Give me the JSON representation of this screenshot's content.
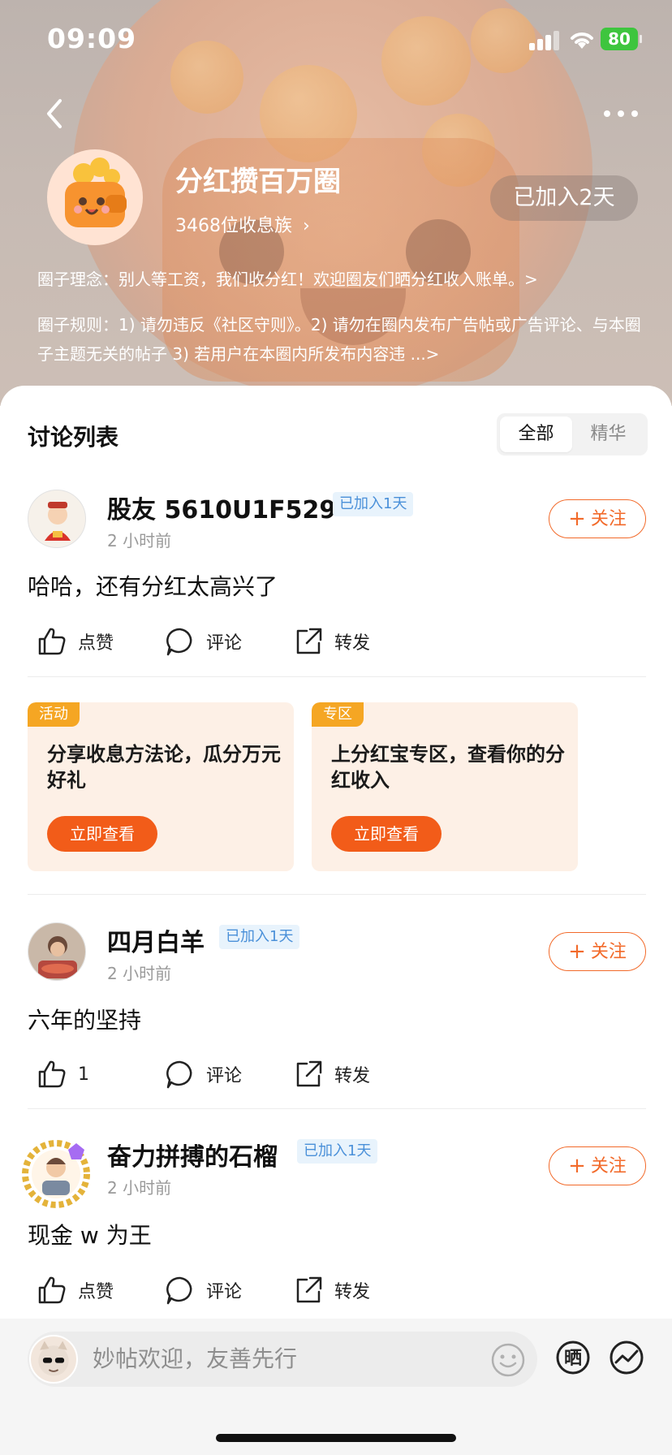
{
  "status_bar": {
    "time": "09:09",
    "battery": "80"
  },
  "header": {
    "circle_name": "分红攒百万圈",
    "members": "3468位收息族",
    "joined": "已加入2天",
    "philosophy": "圈子理念：别人等工资，我们收分红！欢迎圈友们晒分红收入账单。>",
    "rules": "圈子规则：1) 请勿违反《社区守则》。2) 请勿在圈内发布广告帖或广告评论、与本圈子主题无关的帖子 3) 若用户在本圈内所发布内容违 ...>"
  },
  "list": {
    "title": "讨论列表",
    "tabs": [
      "全部",
      "精华"
    ],
    "active_tab": "全部"
  },
  "follow_label": "关注",
  "comment_label": "评论",
  "forward_label": "转发",
  "posts": [
    {
      "username": "股友 5610U1F529",
      "badge": "已加入1天",
      "time": "2 小时前",
      "content": "哈哈，还有分红太高兴了",
      "like_label": "点赞"
    },
    {
      "username": "四月白羊",
      "badge": "已加入1天",
      "time": "2 小时前",
      "content": "六年的坚持",
      "like_label": "1"
    },
    {
      "username": "奋力拼搏的石榴",
      "badge": "已加入1天",
      "time": "2 小时前",
      "content": "现金 w 为王",
      "like_label": "点赞"
    }
  ],
  "promos": [
    {
      "tag": "活动",
      "text": "分享收息方法论，瓜分万元好礼",
      "button": "立即查看"
    },
    {
      "tag": "专区",
      "text": "上分红宝专区，查看你的分红收入",
      "button": "立即查看"
    }
  ],
  "composer": {
    "placeholder": "妙帖欢迎，友善先行",
    "share_icon_glyph": "晒"
  },
  "colors": {
    "accent": "#f26a2a",
    "badge_bg": "#e8f3fc",
    "badge_text": "#4a90d9",
    "promo_bg": "#fdf0e6",
    "promo_button": "#f25c19"
  }
}
